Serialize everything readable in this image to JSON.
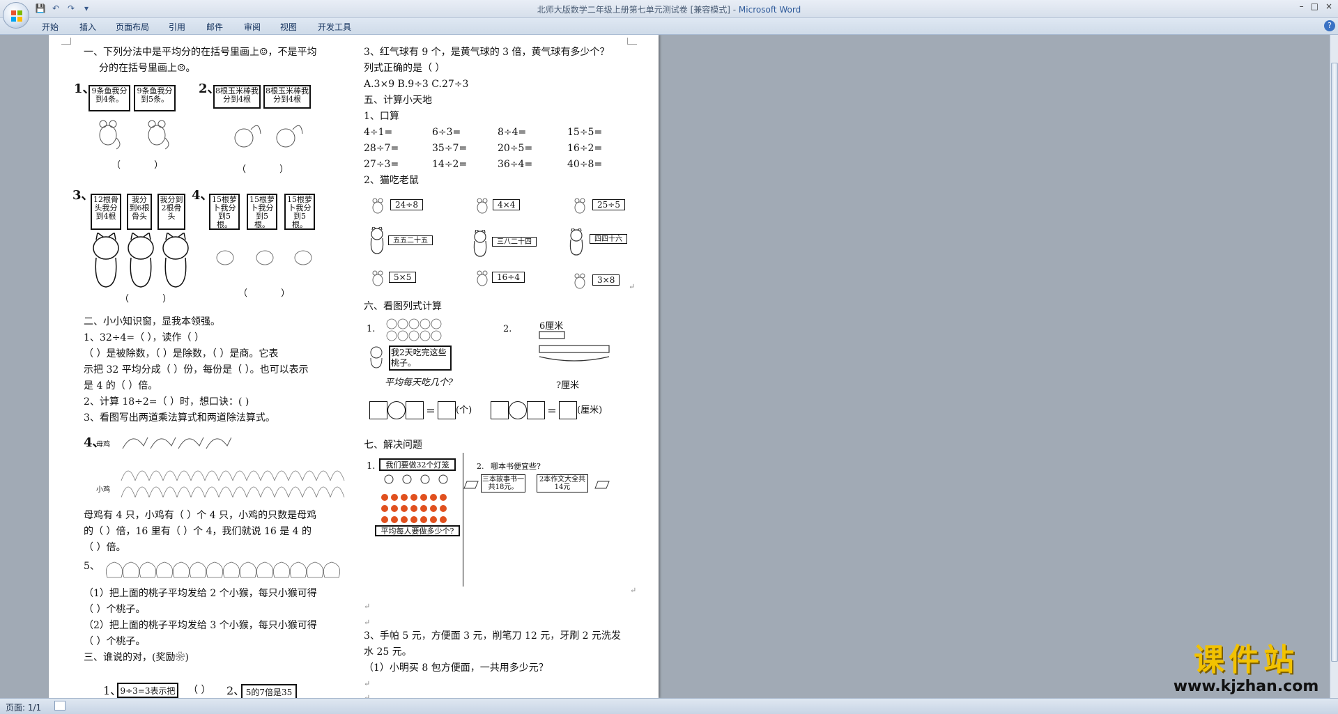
{
  "window": {
    "title_doc": "北师大版数学二年级上册第七单元测试卷 [兼容模式] - ",
    "title_app": "Microsoft Word",
    "controls": [
      "–",
      "□",
      "×"
    ]
  },
  "ribbon": {
    "tabs": [
      "开始",
      "插入",
      "页面布局",
      "引用",
      "邮件",
      "审阅",
      "视图",
      "开发工具"
    ],
    "help_icon": "help-icon"
  },
  "status": {
    "page": "页面: 1/1"
  },
  "watermark": {
    "cn": "课件站",
    "url": "www.kjzhan.com"
  },
  "doc": {
    "left": {
      "q1_l1": "一、下列分法中是平均分的在括号里画上☺，不是平均",
      "q1_l2": "分的在括号里画上☹。",
      "n1": "1、",
      "b1a": "9条鱼我分到4条。",
      "b1b": "9条鱼我分到5条。",
      "n2": "2、",
      "b2a": "8根玉米棒我分到4根",
      "b2b": "8根玉米棒我分到4根",
      "n3": "3、",
      "b3a": "12根骨头我分到4根",
      "b3b": "我分到6根骨头",
      "b3c": "我分到2根骨头",
      "n4": "4、",
      "b4a": "15根萝卜我分到5根。",
      "b4b": "15根萝卜我分到5根。",
      "b4c": "15根萝卜我分到5根。",
      "paren": "（   ）",
      "q2_title": "二、小小知识窗，显我本领强。",
      "q2_1": "1、32÷4=（    ），读作（                                    ）",
      "q2_1b": "（    ）是被除数，（    ）是除数，（    ）是商。它表",
      "q2_1c": "示把 32 平均分成（    ）份，每份是（  ）。也可以表示",
      "q2_1d": "是 4 的（     ）倍。",
      "q2_2": "2、计算 18÷2=（      ）时，想口诀：(                        )",
      "q2_3": "3、看图写出两道乘法算式和两道除法算式。",
      "q4_n": "4、",
      "hen_label": "母鸡",
      "chick_label": "小鸡",
      "q4_t1": "母鸡有 4 只，小鸡有（    ）个 4 只，小鸡的只数是母鸡",
      "q4_t2": "的（    ）倍，16 里有（    ）个 4，我们就说 16 是 4 的",
      "q4_t3": "（    ）倍。",
      "q5_n": "5、",
      "q5_1a": "（1）把上面的桃子平均发给 2 个小猴，每只小猴可得",
      "q5_1b": "（    ）个桃子。",
      "q5_2a": "（2）把上面的桃子平均发给 3 个小猴，每只小猴可得",
      "q5_2b": "（    ）个桃子。",
      "q3_title": "三、谁说的对，(奖励❀)",
      "q3_1": "1、",
      "q3_b1": "9÷3=3表示把",
      "q3_p": "（    ）",
      "q3_2": "2、",
      "q3_b2": "5的7倍是35"
    },
    "right": {
      "r1": "3、红气球有 9 个，是黄气球的 3 倍，黄气球有多少个？",
      "r2": "列式正确的是（     ）",
      "r3": "A.3×9   B.9÷3   C.27÷3",
      "r4": "五、计算小天地",
      "r5": "1、口算",
      "calc": [
        [
          "4÷1=",
          "6÷3=",
          "8÷4=",
          "15÷5="
        ],
        [
          "28÷7=",
          "35÷7=",
          "20÷5=",
          "16÷2="
        ],
        [
          "27÷3=",
          "14÷2=",
          "36÷4=",
          "40÷8="
        ]
      ],
      "r6": "2、猫吃老鼠",
      "mice_top": [
        "24÷8",
        "4×4",
        "25÷5"
      ],
      "cats": [
        "五五二十五",
        "三八二十四",
        "四四十六"
      ],
      "mice_bot": [
        "5×5",
        "16÷4",
        "3×8"
      ],
      "r7": "六、看图列式计算",
      "p1_n": "1.",
      "p1_box": "我2天吃完这些桃子。",
      "p1_q": "平均每天吃几个?",
      "unit1": "(个)",
      "p2_n": "2.",
      "p2_len": "6厘米",
      "p2_q": "?厘米",
      "unit2": "(厘米)",
      "r8": "七、解决问题",
      "s1_n": "1.",
      "s1_box": "我们要做32个灯笼",
      "s1_q": "平均每人要做多少个?",
      "s2_n": "2.",
      "s2_q": "哪本书便宜些?",
      "s2_a": "三本故事书一共18元。",
      "s2_b": "2本作文大全共14元",
      "r9a": "3、手帕 5 元，方便面 3 元，削笔刀 12 元，牙刷 2 元洗发",
      "r9b": "水 25 元。",
      "r10": "（1）小明买 8 包方便面，一共用多少元？"
    }
  }
}
